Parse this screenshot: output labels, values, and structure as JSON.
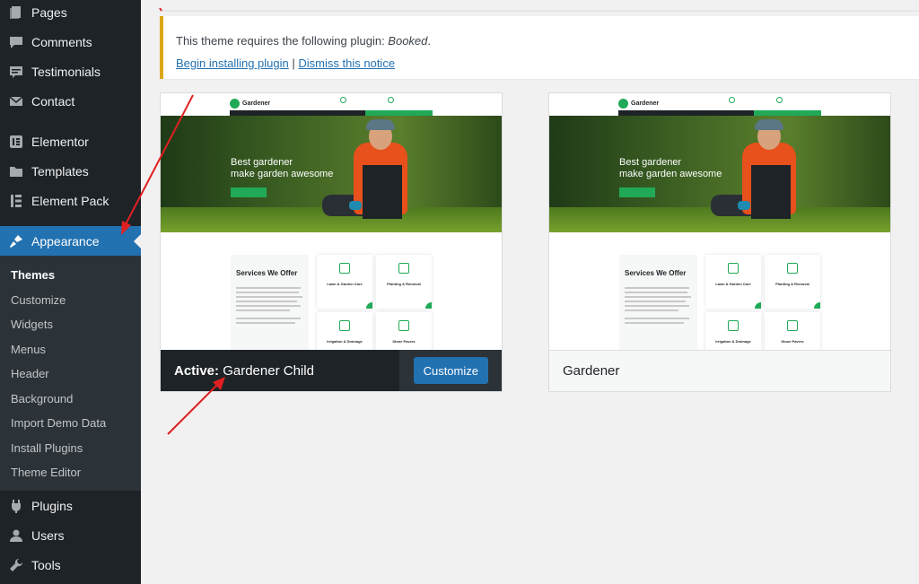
{
  "sidebar": {
    "top_items": [
      {
        "label": "Pages",
        "icon": "pages-icon"
      },
      {
        "label": "Comments",
        "icon": "comments-icon"
      },
      {
        "label": "Testimonials",
        "icon": "testimonials-icon"
      },
      {
        "label": "Contact",
        "icon": "contact-icon"
      },
      {
        "label": "Elementor",
        "icon": "elementor-icon"
      },
      {
        "label": "Templates",
        "icon": "templates-icon"
      },
      {
        "label": "Element Pack",
        "icon": "element-pack-icon"
      }
    ],
    "current": {
      "label": "Appearance",
      "icon": "appearance-icon"
    },
    "submenu": [
      "Themes",
      "Customize",
      "Widgets",
      "Menus",
      "Header",
      "Background",
      "Import Demo Data",
      "Install Plugins",
      "Theme Editor"
    ],
    "bottom_items": [
      {
        "label": "Plugins",
        "icon": "plugins-icon"
      },
      {
        "label": "Users",
        "icon": "users-icon"
      },
      {
        "label": "Tools",
        "icon": "tools-icon"
      }
    ]
  },
  "notice": {
    "text_prefix": "This theme requires the following plugin: ",
    "plugin_name": "Booked",
    "text_suffix": ".",
    "install_link": "Begin installing plugin",
    "separator": "|",
    "dismiss_link": "Dismiss this notice"
  },
  "themes": [
    {
      "active_label": "Active:",
      "name": "Gardener Child",
      "button": "Customize"
    },
    {
      "name": "Gardener"
    }
  ],
  "preview": {
    "logo": "Gardener",
    "hero_title_line1": "Best gardener",
    "hero_title_line2": "make garden awesome",
    "services_title": "Services We Offer",
    "services": [
      "Lawn & Garden Care",
      "Planting & Removal",
      "Irrigation & Drainage",
      "Stone Pavers"
    ]
  },
  "colors": {
    "sidebar_bg": "#1d2327",
    "accent": "#2271b1",
    "notice_border": "#dba617",
    "annotation": "#e02020",
    "brand_green": "#21a957"
  }
}
